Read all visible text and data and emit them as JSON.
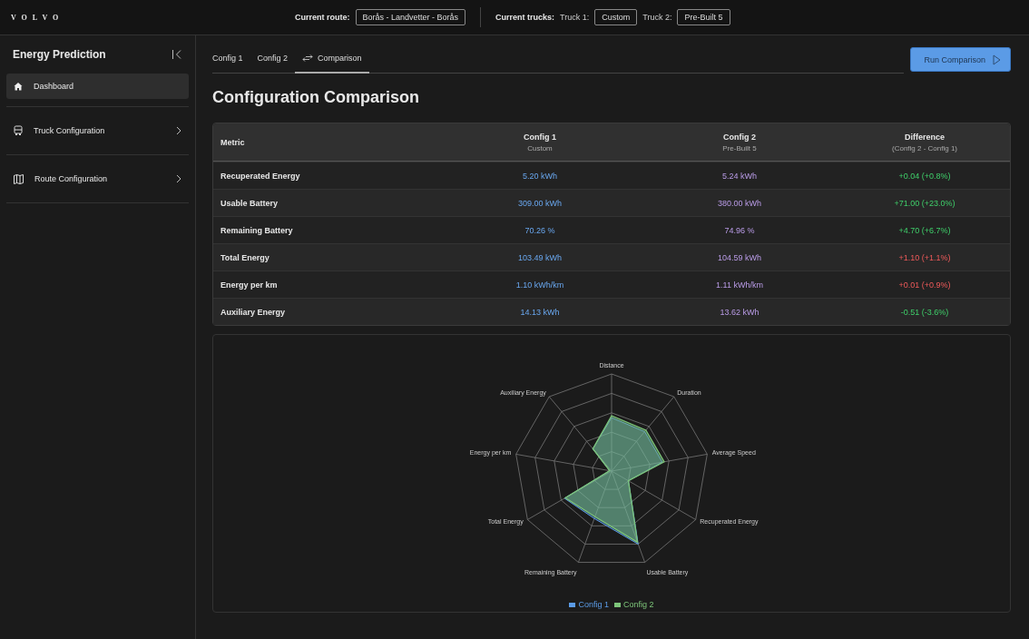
{
  "topbar": {
    "logo": "VOLVO",
    "route_label": "Current route:",
    "route": "Borås - Landvetter - Borås",
    "trucks_label": "Current trucks:",
    "trucks": [
      {
        "label": "Truck 1:",
        "value": "Custom"
      },
      {
        "label": "Truck 2:",
        "value": "Pre-Built 5"
      }
    ]
  },
  "sidebar": {
    "title": "Energy Prediction",
    "items": [
      {
        "label": "Dashboard",
        "selected": true,
        "has_arrow": false
      },
      {
        "label": "Truck Configuration",
        "selected": false,
        "has_arrow": true
      },
      {
        "label": "Route Configuration",
        "selected": false,
        "has_arrow": true
      }
    ]
  },
  "tabs": [
    {
      "label": "Config 1",
      "selected": false,
      "icon": false
    },
    {
      "label": "Config 2",
      "selected": false,
      "icon": false
    },
    {
      "label": "Comparison",
      "selected": true,
      "icon": true
    }
  ],
  "run_button": "Run Comparison",
  "heading": "Configuration Comparison",
  "table": {
    "columns": [
      {
        "title": "Metric"
      },
      {
        "title": "Config 1",
        "subtitle": "Custom"
      },
      {
        "title": "Config 2",
        "subtitle": "Pre-Built 5"
      },
      {
        "title": "Difference",
        "subtitle": "(Config 2 - Config 1)"
      }
    ],
    "rows": [
      {
        "metric": "Recuperated Energy",
        "config_1": "5.20 kWh",
        "config_2": "5.24 kWh",
        "difference": "+0.04 (+0.8%)",
        "better": true
      },
      {
        "metric": "Usable Battery",
        "config_1": "309.00 kWh",
        "config_2": "380.00 kWh",
        "difference": "+71.00 (+23.0%)",
        "better": true
      },
      {
        "metric": "Remaining Battery",
        "config_1": "70.26 %",
        "config_2": "74.96 %",
        "difference": "+4.70 (+6.7%)",
        "better": true
      },
      {
        "metric": "Total Energy",
        "config_1": "103.49 kWh",
        "config_2": "104.59 kWh",
        "difference": "+1.10 (+1.1%)",
        "better": false
      },
      {
        "metric": "Energy per km",
        "config_1": "1.10 kWh/km",
        "config_2": "1.11 kWh/km",
        "difference": "+0.01 (+0.9%)",
        "better": false
      },
      {
        "metric": "Auxiliary Energy",
        "config_1": "14.13 kWh",
        "config_2": "13.62 kWh",
        "difference": "-0.51 (-3.6%)",
        "better": true
      }
    ]
  },
  "radar": {
    "axis_rows": [
      {
        "labels": [
          "Distance"
        ]
      },
      {
        "labels": [
          "Auxiliary Energy",
          "Duration"
        ]
      },
      {
        "labels": [
          "Energy per km",
          "Average Speed"
        ]
      },
      {
        "labels": [
          "Total Energy",
          "Recuperated Energy"
        ]
      },
      {
        "labels": [
          "Remaining Battery",
          "Usable Battery"
        ]
      }
    ],
    "legend": [
      {
        "label": "Config 1",
        "color": "#5b9be6"
      },
      {
        "label": "Config 2",
        "color": "#7dc57a"
      }
    ]
  }
}
